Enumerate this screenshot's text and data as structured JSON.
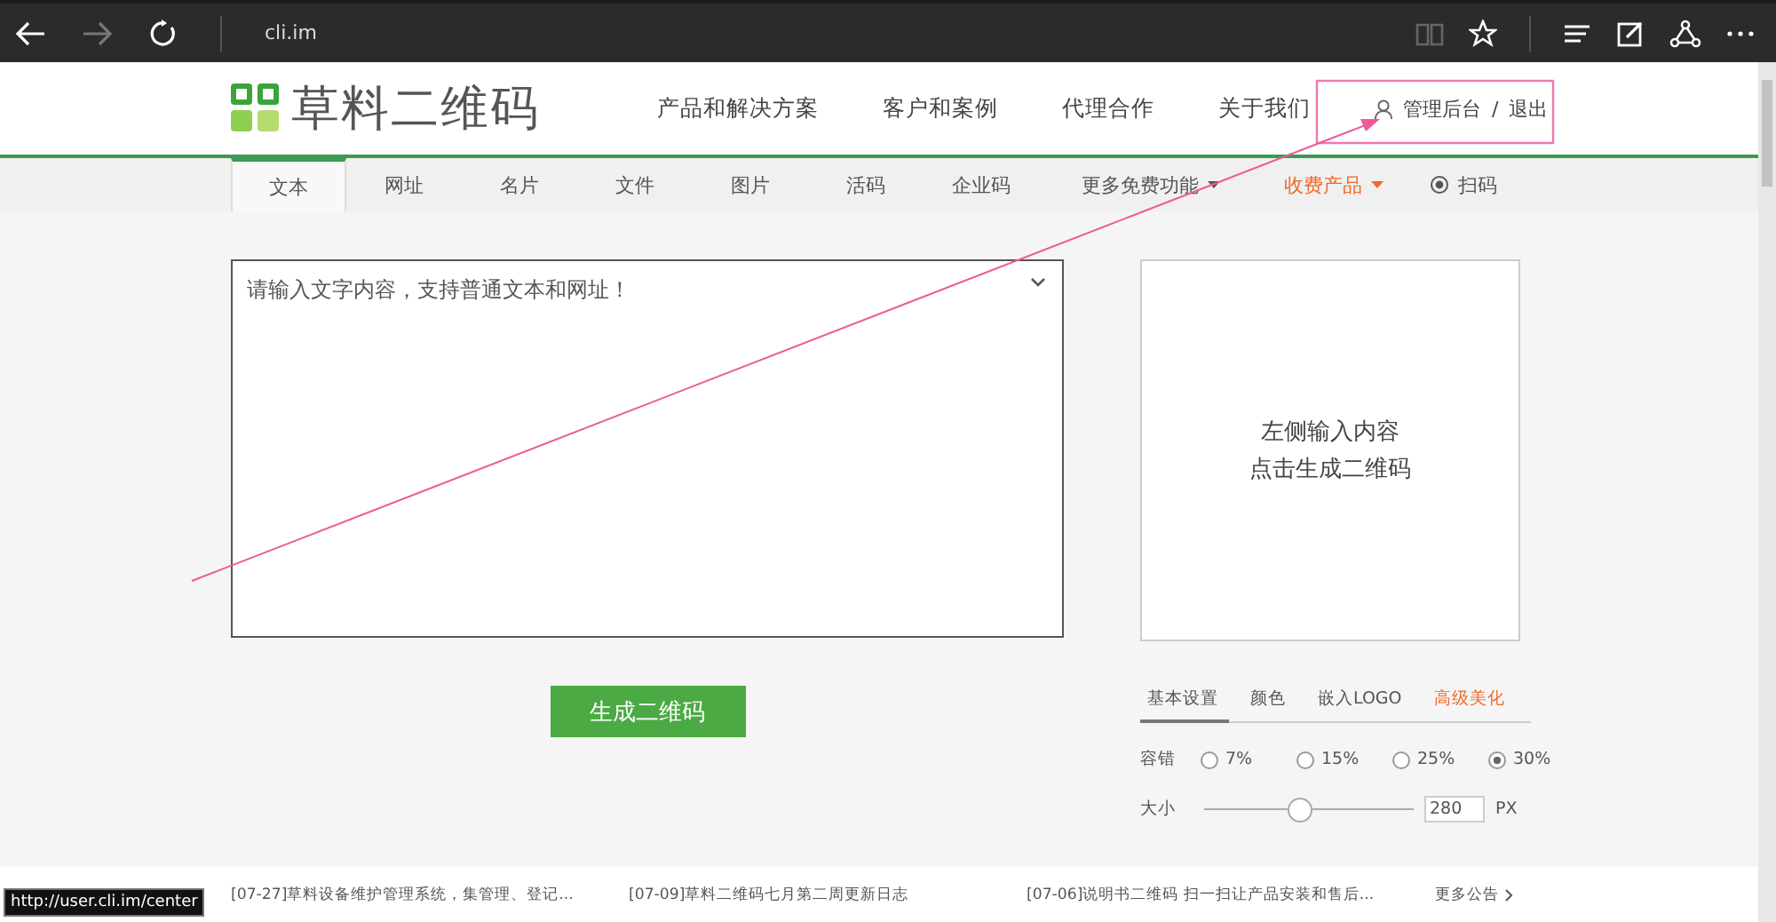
{
  "browser": {
    "address": "cli.im"
  },
  "header": {
    "logo_text": "草料二维码",
    "nav": [
      "产品和解决方案",
      "客户和案例",
      "代理合作",
      "关于我们"
    ],
    "account": {
      "admin": "管理后台",
      "separator": "/",
      "logout": "退出"
    }
  },
  "tabs": [
    {
      "label": "文本",
      "selected": true,
      "kind": "plain"
    },
    {
      "label": "网址",
      "selected": false,
      "kind": "plain"
    },
    {
      "label": "名片",
      "selected": false,
      "kind": "plain"
    },
    {
      "label": "文件",
      "selected": false,
      "kind": "plain"
    },
    {
      "label": "图片",
      "selected": false,
      "kind": "plain"
    },
    {
      "label": "活码",
      "selected": false,
      "kind": "plain"
    },
    {
      "label": "企业码",
      "selected": false,
      "kind": "plain"
    },
    {
      "label": "更多免费功能",
      "selected": false,
      "kind": "dropdown"
    },
    {
      "label": "收费产品",
      "selected": false,
      "kind": "paid"
    },
    {
      "label": "扫码",
      "selected": false,
      "kind": "scan"
    }
  ],
  "editor": {
    "placeholder": "请输入文字内容，支持普通文本和网址！"
  },
  "generate_button": "生成二维码",
  "preview": {
    "lines": [
      "左侧输入内容",
      "点击生成二维码"
    ]
  },
  "settings": {
    "tabs": [
      {
        "label": "基本设置",
        "selected": true,
        "kind": "plain"
      },
      {
        "label": "颜色",
        "selected": false,
        "kind": "plain"
      },
      {
        "label": "嵌入LOGO",
        "selected": false,
        "kind": "plain"
      },
      {
        "label": "高级美化",
        "selected": false,
        "kind": "highlight"
      }
    ],
    "error_correction": {
      "label": "容错",
      "options": [
        {
          "label": "7%",
          "selected": false
        },
        {
          "label": "15%",
          "selected": false
        },
        {
          "label": "25%",
          "selected": false
        },
        {
          "label": "30%",
          "selected": true
        }
      ]
    },
    "size": {
      "label": "大小",
      "level": 0.45,
      "value": "280",
      "unit": "PX"
    }
  },
  "news": [
    "[07-27]草料设备维护管理系统，集管理、登记...",
    "[07-09]草料二维码七月第二周更新日志",
    "[07-06]说明书二维码 扫一扫让产品安装和售后..."
  ],
  "more_news": "更多公告",
  "status_url": "http://user.cli.im/center"
}
